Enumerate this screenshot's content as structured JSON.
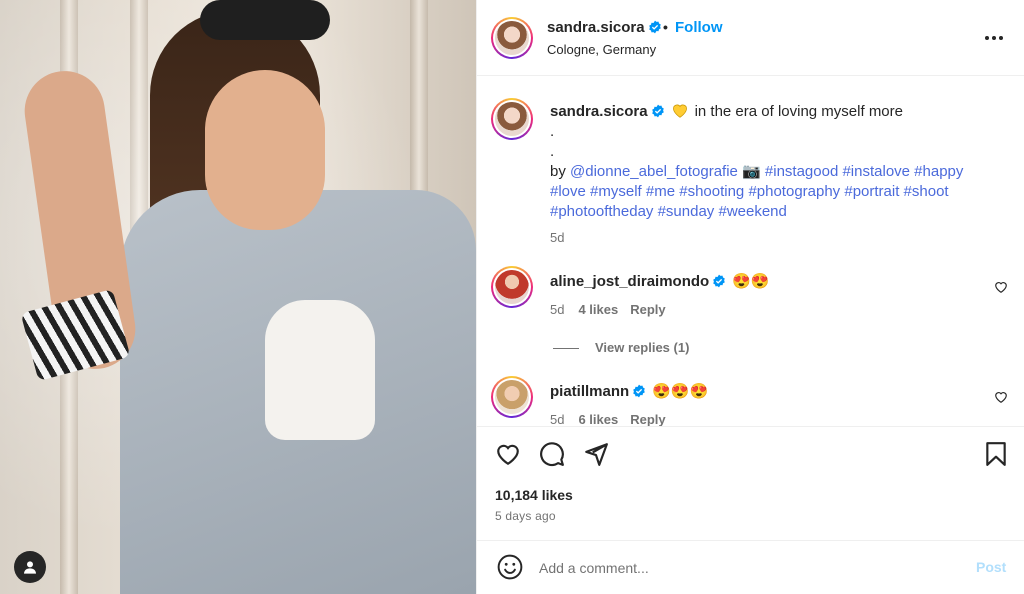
{
  "post": {
    "author": "sandra.sicora",
    "location": "Cologne, Germany",
    "follow_label": "Follow",
    "dot": "•",
    "caption": {
      "text": "in the era of loving myself more",
      "line2": ".",
      "line3": ".",
      "by": "by",
      "mention": "@dionne_abel_fotografie",
      "camera_emoji": "📷",
      "hashtags_line1": "#instagood #instalove #happy",
      "hashtags_line2": "#love #myself #me #shooting #photography #portrait #shoot",
      "hashtags_line3": "#photooftheday #sunday #weekend",
      "age": "5d"
    },
    "likes": "10,184 likes",
    "time_ago": "5 days ago"
  },
  "comments": [
    {
      "user": "aline_jost_diraimondo",
      "text": "😍😍",
      "age": "5d",
      "likes": "4 likes",
      "reply": "Reply"
    },
    {
      "user": "piatillmann",
      "text": "😍😍😍",
      "age": "5d",
      "likes": "6 likes",
      "reply": "Reply"
    }
  ],
  "view_replies": "View replies (1)",
  "add_comment": {
    "placeholder": "Add a comment...",
    "post_label": "Post"
  },
  "colors": {
    "accent": "#0095f6",
    "hashtag": "#4b6adb",
    "muted": "#737373",
    "verified": "#0095f6"
  },
  "icons": [
    "user-icon",
    "verified-icon",
    "more-icon",
    "heart-icon",
    "comment-icon",
    "share-icon",
    "bookmark-icon",
    "emoji-icon",
    "yellow-heart-icon"
  ]
}
